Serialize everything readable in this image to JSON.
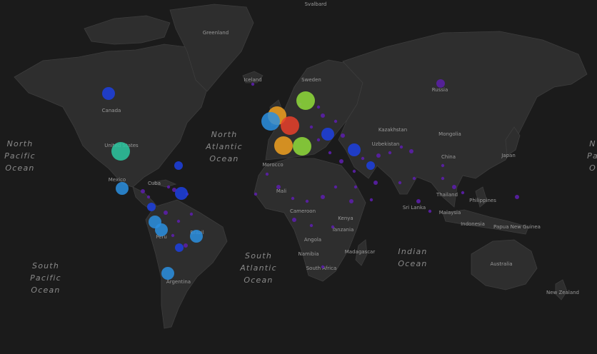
{
  "ocean_labels": [
    {
      "id": "north-pacific-ocean",
      "lines": [
        "North",
        "Pacific",
        "Ocean"
      ]
    },
    {
      "id": "north-atlantic-ocean",
      "lines": [
        "North",
        "Atlantic",
        "Ocean"
      ]
    },
    {
      "id": "south-pacific-ocean",
      "lines": [
        "South",
        "Pacific",
        "Ocean"
      ]
    },
    {
      "id": "south-atlantic-ocean",
      "lines": [
        "South",
        "Atlantic",
        "Ocean"
      ]
    },
    {
      "id": "indian-ocean",
      "lines": [
        "Indian",
        "Ocean"
      ]
    },
    {
      "id": "north-pacific-ocean-east",
      "lines": [
        "N",
        "Pa",
        "O"
      ]
    }
  ],
  "place_labels": [
    "Svalbard",
    "Greenland",
    "Iceland",
    "Sweden",
    "Russia",
    "Canada",
    "United States",
    "Kazakhstan",
    "Mongolia",
    "Uzbekistan",
    "China",
    "Japan",
    "Mexico",
    "Cuba",
    "Morocco",
    "Mali",
    "Cameroon",
    "Kenya",
    "Tanzania",
    "Angola",
    "Namibia",
    "South Africa",
    "Madagascar",
    "Sri Lanka",
    "Thailand",
    "Philippines",
    "Malaysia",
    "Indonesia",
    "Papua New Guinea",
    "Australia",
    "New Zealand",
    "Brazil",
    "Peru",
    "Argentina"
  ],
  "colors": {
    "background": "#1b1b1b",
    "land": "#2e2e2e",
    "border": "#3d3d3d",
    "purple": "#5b1fa8",
    "blue": "#1c3fe0",
    "lightblue": "#2a8fe0",
    "teal": "#2cc7a0",
    "green": "#8fdc3a",
    "orange": "#f0a020",
    "red": "#e8402a"
  },
  "markers": [
    {
      "region": "canada",
      "color": "#1c3fe0",
      "size": "medium"
    },
    {
      "region": "united-states",
      "color": "#2cc7a0",
      "size": "large"
    },
    {
      "region": "us-east-coast",
      "color": "#1c3fe0",
      "size": "small"
    },
    {
      "region": "mexico",
      "color": "#2a8fe0",
      "size": "medium"
    },
    {
      "region": "caribbean",
      "color": "#1c3fe0",
      "size": "medium"
    },
    {
      "region": "colombia",
      "color": "#1c3fe0",
      "size": "small"
    },
    {
      "region": "ecuador",
      "color": "#2a8fe0",
      "size": "medium"
    },
    {
      "region": "peru",
      "color": "#2a8fe0",
      "size": "medium"
    },
    {
      "region": "brazil",
      "color": "#2a8fe0",
      "size": "medium"
    },
    {
      "region": "bolivia",
      "color": "#1c3fe0",
      "size": "small"
    },
    {
      "region": "argentina",
      "color": "#2a8fe0",
      "size": "medium"
    },
    {
      "region": "sweden",
      "color": "#8fdc3a",
      "size": "large"
    },
    {
      "region": "united-kingdom",
      "color": "#f0a020",
      "size": "large"
    },
    {
      "region": "ireland",
      "color": "#2a8fe0",
      "size": "large"
    },
    {
      "region": "germany",
      "color": "#e8402a",
      "size": "large"
    },
    {
      "region": "france",
      "color": "#f0a020",
      "size": "large"
    },
    {
      "region": "italy",
      "color": "#8fdc3a",
      "size": "large"
    },
    {
      "region": "central-europe",
      "color": "#1c3fe0",
      "size": "medium"
    },
    {
      "region": "turkey",
      "color": "#1c3fe0",
      "size": "medium"
    },
    {
      "region": "iran",
      "color": "#1c3fe0",
      "size": "small"
    },
    {
      "region": "russia",
      "color": "#5b1fa8",
      "size": "small"
    }
  ]
}
